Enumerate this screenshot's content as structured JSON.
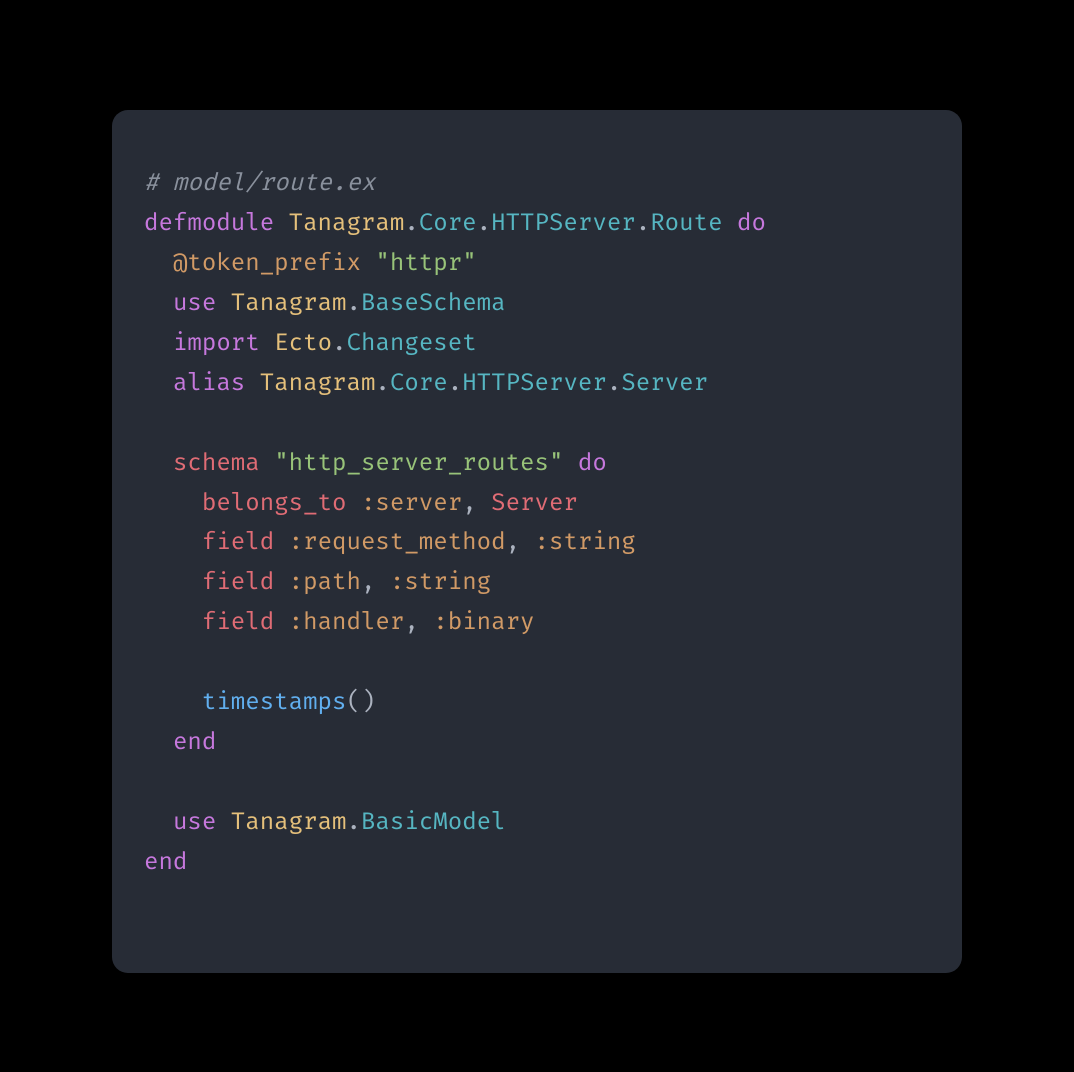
{
  "code": {
    "l1_comment": "# model/route.ex",
    "l2": {
      "kw1": "defmodule",
      "m1": "Tanagram",
      "d1": ".",
      "m2": "Core",
      "d2": ".",
      "m3": "HTTPServer",
      "d3": ".",
      "m4": "Route",
      "kw2": "do"
    },
    "l3": {
      "attr": "@token_prefix",
      "str": "\"httpr\""
    },
    "l4": {
      "kw": "use",
      "m1": "Tanagram",
      "d": ".",
      "m2": "BaseSchema"
    },
    "l5": {
      "kw": "import",
      "m1": "Ecto",
      "d": ".",
      "m2": "Changeset"
    },
    "l6": {
      "kw": "alias",
      "m1": "Tanagram",
      "d1": ".",
      "m2": "Core",
      "d2": ".",
      "m3": "HTTPServer",
      "d3": ".",
      "m4": "Server"
    },
    "l8": {
      "kw1": "schema",
      "str": "\"http_server_routes\"",
      "kw2": "do"
    },
    "l9": {
      "call": "belongs_to",
      "a1": ":server",
      "c": ",",
      "type": "Server"
    },
    "l10": {
      "call": "field",
      "a1": ":request_method",
      "c": ",",
      "a2": ":string"
    },
    "l11": {
      "call": "field",
      "a1": ":path",
      "c": ",",
      "a2": ":string"
    },
    "l12": {
      "call": "field",
      "a1": ":handler",
      "c": ",",
      "a2": ":binary"
    },
    "l14": {
      "fn": "timestamps",
      "p": "()"
    },
    "l15": {
      "kw": "end"
    },
    "l17": {
      "kw": "use",
      "m1": "Tanagram",
      "d": ".",
      "m2": "BasicModel"
    },
    "l18": {
      "kw": "end"
    }
  }
}
